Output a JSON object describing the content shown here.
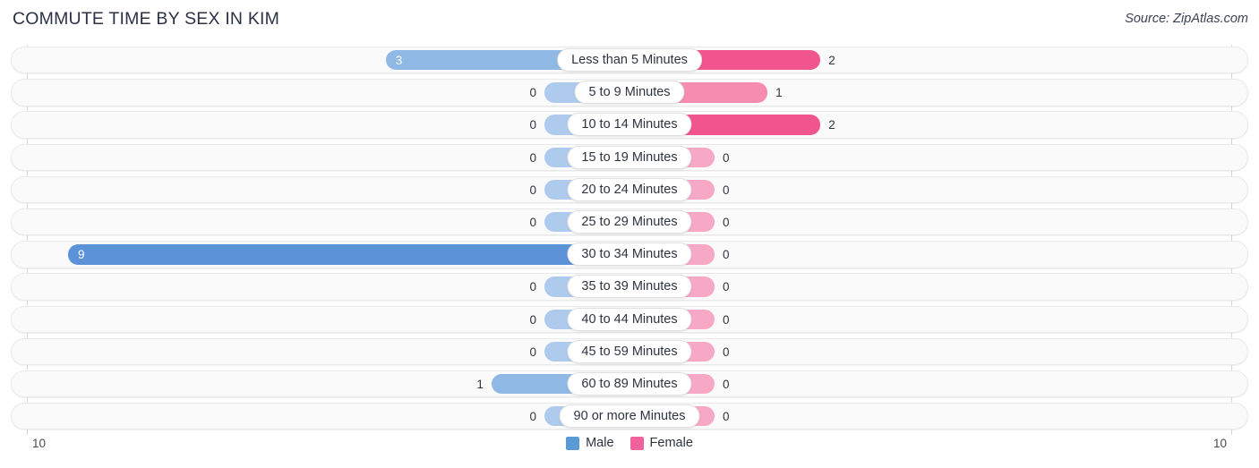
{
  "header": {
    "title": "COMMUTE TIME BY SEX IN KIM",
    "source": "Source: ZipAtlas.com"
  },
  "axis": {
    "left_tick": "10",
    "right_tick": "10"
  },
  "legend": {
    "items": [
      {
        "label": "Male",
        "color": "#5b9bd5"
      },
      {
        "label": "Female",
        "color": "#f0629b"
      }
    ]
  },
  "colors": {
    "male_zero": "#aecbee",
    "male_low": "#8fb9e4",
    "male_high": "#5b92d8",
    "female_zero": "#f7a8c4",
    "female_low": "#f68cb0",
    "female_high": "#f0558e",
    "track": "#fafafa",
    "track_border": "#e9e9e9"
  },
  "chart_data": {
    "type": "bar",
    "title": "COMMUTE TIME BY SEX IN KIM",
    "subtitle": "Source: ZipAtlas.com",
    "orientation": "horizontal-diverging",
    "xlabel": "",
    "ylabel": "",
    "xlim": [
      10,
      10
    ],
    "grid": false,
    "legend_position": "bottom-center",
    "categories": [
      "Less than 5 Minutes",
      "5 to 9 Minutes",
      "10 to 14 Minutes",
      "15 to 19 Minutes",
      "20 to 24 Minutes",
      "25 to 29 Minutes",
      "30 to 34 Minutes",
      "35 to 39 Minutes",
      "40 to 44 Minutes",
      "45 to 59 Minutes",
      "60 to 89 Minutes",
      "90 or more Minutes"
    ],
    "series": [
      {
        "name": "Male",
        "values": [
          3,
          0,
          0,
          0,
          0,
          0,
          9,
          0,
          0,
          0,
          1,
          0
        ]
      },
      {
        "name": "Female",
        "values": [
          2,
          1,
          2,
          0,
          0,
          0,
          0,
          0,
          0,
          0,
          0,
          0
        ]
      }
    ]
  },
  "rows": [
    {
      "label": "Less than 5 Minutes",
      "male": "3",
      "female": "2"
    },
    {
      "label": "5 to 9 Minutes",
      "male": "0",
      "female": "1"
    },
    {
      "label": "10 to 14 Minutes",
      "male": "0",
      "female": "2"
    },
    {
      "label": "15 to 19 Minutes",
      "male": "0",
      "female": "0"
    },
    {
      "label": "20 to 24 Minutes",
      "male": "0",
      "female": "0"
    },
    {
      "label": "25 to 29 Minutes",
      "male": "0",
      "female": "0"
    },
    {
      "label": "30 to 34 Minutes",
      "male": "9",
      "female": "0"
    },
    {
      "label": "35 to 39 Minutes",
      "male": "0",
      "female": "0"
    },
    {
      "label": "40 to 44 Minutes",
      "male": "0",
      "female": "0"
    },
    {
      "label": "45 to 59 Minutes",
      "male": "0",
      "female": "0"
    },
    {
      "label": "60 to 89 Minutes",
      "male": "1",
      "female": "0"
    },
    {
      "label": "90 or more Minutes",
      "male": "0",
      "female": "0"
    }
  ]
}
